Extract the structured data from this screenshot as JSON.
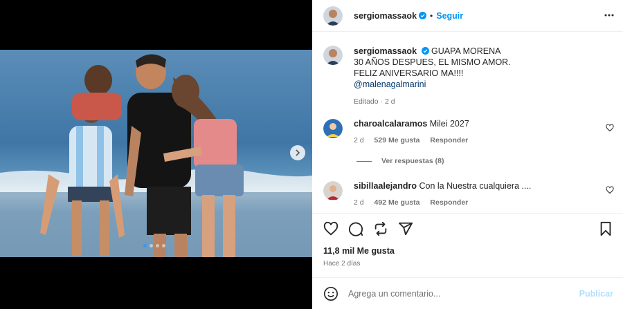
{
  "post": {
    "author": "sergiomassaok",
    "separator": "•",
    "follow_label": "Seguir",
    "caption_lines": [
      "GUAPA MORENA",
      "30 AÑOS DESPUES, EL MISMO AMOR.",
      "FELIZ ANIVERSARIO MA!!!!"
    ],
    "mention": "@malenagalmarini",
    "caption_meta": "Editado · 2 d",
    "likes": "11,8 mil Me gusta",
    "posted": "Hace 2 días",
    "carousel": {
      "count": 4,
      "active": 0
    }
  },
  "comments": [
    {
      "user": "charoalcalaramos",
      "text": "Milei 2027",
      "age": "2 d",
      "likes": "529 Me gusta",
      "reply_label": "Responder"
    },
    {
      "user": "sibillaalejandro",
      "text": "Con la Nuestra cualquiera ....",
      "age": "2 d",
      "likes": "492 Me gusta",
      "reply_label": "Responder"
    }
  ],
  "view_replies": "Ver respuestas (8)",
  "composer": {
    "placeholder": "Agrega un comentario...",
    "publish": "Publicar"
  },
  "colors": {
    "link": "#0095f6",
    "verified": "#0095f6",
    "publish_disabled": "#b2dffc"
  },
  "icons": [
    "chevron-right-icon",
    "more-icon",
    "verified-icon",
    "heart-icon",
    "comment-icon",
    "share-icon",
    "send-icon",
    "bookmark-icon",
    "emoji-icon"
  ]
}
